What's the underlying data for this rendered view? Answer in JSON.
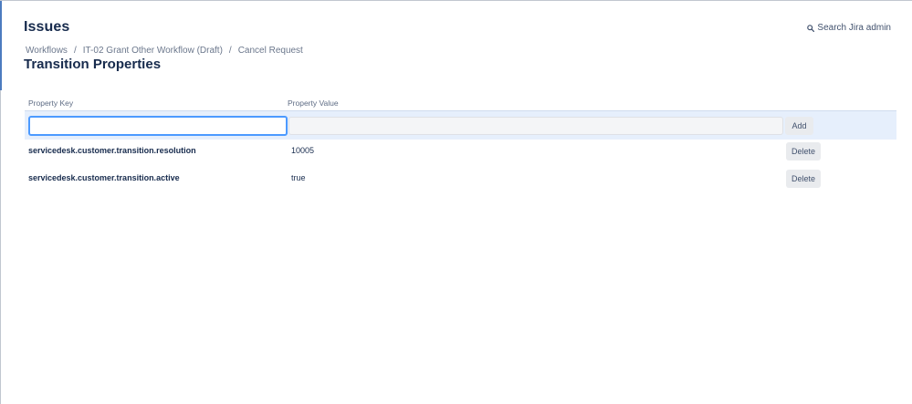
{
  "header": {
    "title": "Issues",
    "search_label": "Search Jira admin"
  },
  "breadcrumb": {
    "items": [
      "Workflows",
      "IT-02 Grant Other Workflow (Draft)",
      "Cancel Request"
    ],
    "separator": "/"
  },
  "page_title": "Transition Properties",
  "table": {
    "columns": {
      "key": "Property Key",
      "value": "Property Value"
    },
    "add_row": {
      "key_value": "",
      "value_value": "",
      "add_label": "Add"
    },
    "rows": [
      {
        "key": "servicedesk.customer.transition.resolution",
        "value": "10005",
        "action": "Delete"
      },
      {
        "key": "servicedesk.customer.transition.active",
        "value": "true",
        "action": "Delete"
      }
    ]
  },
  "icons": {
    "search": "search-icon"
  },
  "colors": {
    "accent": "#4c9aff",
    "add_row_bg": "#e6effc",
    "text_primary": "#172b4d",
    "text_secondary": "#6b778c"
  }
}
